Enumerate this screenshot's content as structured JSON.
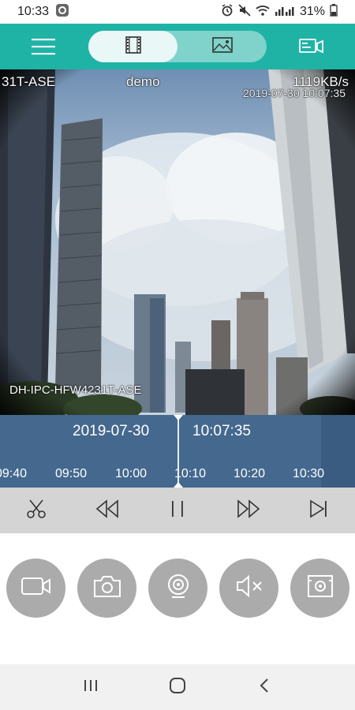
{
  "status_bar": {
    "time": "10:33",
    "battery": "31%",
    "icons": [
      "media-icon",
      "alarm-icon",
      "mute-icon",
      "wifi-icon",
      "signal-icon",
      "battery-icon"
    ]
  },
  "toolbar": {
    "menu_icon": "menu-icon",
    "segments": [
      {
        "name": "video-playback",
        "icon": "film-icon",
        "selected": true
      },
      {
        "name": "image",
        "icon": "image-icon",
        "selected": false
      }
    ],
    "right_icon": "camera-list-icon",
    "accent": "#1fb3a6"
  },
  "video": {
    "channel_label": "31T-ASE",
    "title": "demo",
    "bitrate": "1119KB/s",
    "timestamp": "2019-07-30 10:07:35",
    "model_label": "DH-IPC-HFW4231T-ASE"
  },
  "timeline": {
    "date": "2019-07-30",
    "time": "10:07:35",
    "ticks": [
      "09:40",
      "09:50",
      "10:00",
      "10:10",
      "10:20",
      "10:30"
    ],
    "colors": {
      "background": "#3a5c80",
      "recorded": "#44688e"
    }
  },
  "controls": [
    {
      "name": "clip-button",
      "icon": "scissors-icon"
    },
    {
      "name": "step-back-button",
      "icon": "rewind-icon"
    },
    {
      "name": "pause-button",
      "icon": "pause-icon"
    },
    {
      "name": "fast-forward-button",
      "icon": "fast-forward-icon"
    },
    {
      "name": "next-button",
      "icon": "skip-next-icon"
    }
  ],
  "actions": [
    {
      "name": "record-button",
      "icon": "video-camera-icon"
    },
    {
      "name": "snapshot-button",
      "icon": "camera-icon"
    },
    {
      "name": "fisheye-button",
      "icon": "fisheye-icon"
    },
    {
      "name": "sound-button",
      "icon": "speaker-mute-icon"
    },
    {
      "name": "capture-frame-button",
      "icon": "frame-capture-icon"
    }
  ],
  "nav_bar": [
    "recent-apps-icon",
    "home-icon",
    "back-icon"
  ]
}
